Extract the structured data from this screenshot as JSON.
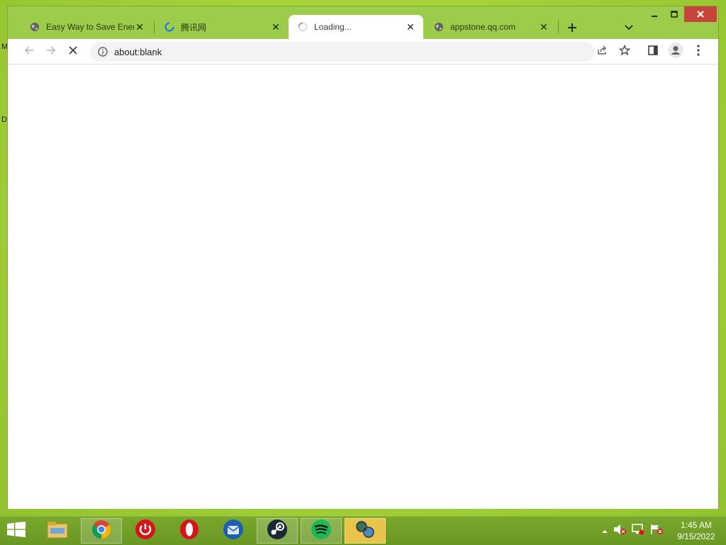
{
  "desktop": {
    "edge_labels": [
      "M",
      "D"
    ]
  },
  "browser": {
    "tabs": [
      {
        "title": "Easy Way to Save Energ",
        "favicon": "globe-icon",
        "active": false
      },
      {
        "title": "腾讯网",
        "favicon": "loading-spinner-icon",
        "active": false
      },
      {
        "title": "Loading...",
        "favicon": "loading-spinner-icon",
        "active": true
      },
      {
        "title": "appstone.qq.com",
        "favicon": "globe-icon",
        "active": false
      }
    ],
    "omnibox": {
      "url": "about:blank"
    }
  },
  "taskbar": {
    "apps": [
      "file-explorer-icon",
      "chrome-icon",
      "power-app-icon",
      "opera-icon",
      "thunderbird-icon",
      "steam-icon",
      "spotify-icon",
      "network-app-icon"
    ],
    "clock": {
      "time": "1:45 AM",
      "date": "9/15/2022"
    }
  },
  "colors": {
    "desktop": "#a9d33a",
    "window_frame": "#9ccc4a",
    "close_button": "#c7443a",
    "spotify": "#1db954",
    "opera": "#d7141a",
    "chrome_red": "#db4437",
    "chrome_yellow": "#f4b400",
    "chrome_green": "#0f9d58",
    "chrome_blue": "#4285f4"
  }
}
